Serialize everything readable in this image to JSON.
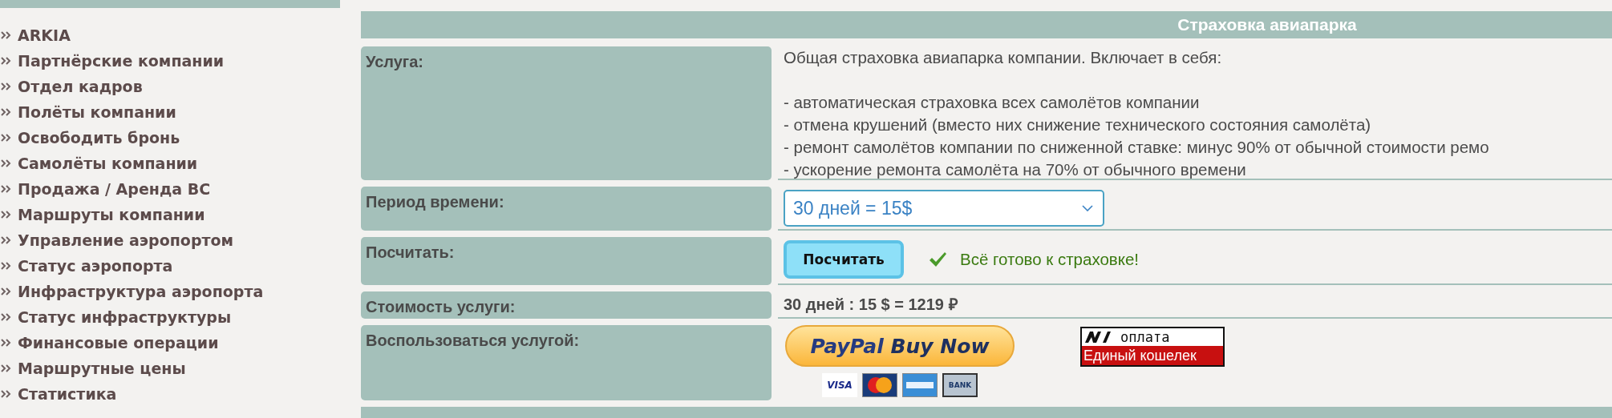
{
  "sidebar": {
    "items": [
      {
        "label": "ARKIA"
      },
      {
        "label": "Партнёрские компании"
      },
      {
        "label": "Отдел кадров"
      },
      {
        "label": "Полёты компании"
      },
      {
        "label": "Освободить бронь"
      },
      {
        "label": "Самолёты компании"
      },
      {
        "label": "Продажа / Аренда ВС"
      },
      {
        "label": "Маршруты компании"
      },
      {
        "label": "Управление аэропортом"
      },
      {
        "label": "Статус аэропорта"
      },
      {
        "label": "Инфраструктура аэропорта"
      },
      {
        "label": "Статус инфраструктуры"
      },
      {
        "label": "Финансовые операции"
      },
      {
        "label": "Маршрутные цены"
      },
      {
        "label": "Статистика"
      }
    ]
  },
  "panel": {
    "title": "Страховка авиапарка",
    "rows": [
      {
        "kind": "description",
        "label": "Услуга:",
        "intro": "Общая страховка авиапарка компании. Включает в себя:",
        "items": [
          "- автоматическая страховка всех самолётов компании",
          "- отмена крушений (вместо них снижение технического состояния самолёта)",
          "- ремонт самолётов компании по сниженной ставке: минус 90% от обычной стоимости ремо",
          "- ускорение ремонта самолёта на 70% от обычного времени"
        ]
      },
      {
        "kind": "select",
        "label": "Период времени:",
        "value": "30 дней = 15$"
      },
      {
        "kind": "action",
        "label": "Посчитать:",
        "button": "Посчитать",
        "status": "Всё готово к страховке!"
      },
      {
        "kind": "cost",
        "label": "Стоимость услуги:",
        "value": "30 дней : 15 $ = 1219 ₽"
      },
      {
        "kind": "payment",
        "label": "Воспользоваться услугой:",
        "paypal": {
          "brand": "PayPal",
          "action": "Buy Now"
        },
        "cards": [
          {
            "kind": "visa",
            "label": "VISA"
          },
          {
            "kind": "mastercard"
          },
          {
            "kind": "amex"
          },
          {
            "kind": "bank",
            "label": "BANK"
          }
        ],
        "wallet": {
          "top": "оплата",
          "bottom": "Единый кошелек"
        }
      }
    ]
  }
}
